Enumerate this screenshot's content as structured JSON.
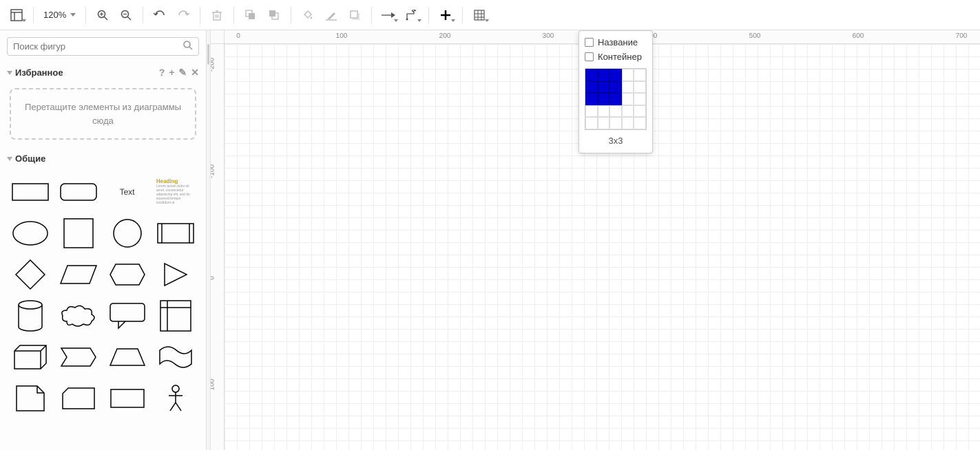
{
  "toolbar": {
    "zoom_label": "120%"
  },
  "sidebar": {
    "search_placeholder": "Поиск фигур",
    "favorites_title": "Избранное",
    "favorites_help": "?",
    "favorites_drop_hint": "Перетащите элементы из диаграммы сюда",
    "general_title": "Общие",
    "shape_text_label": "Text",
    "shape_heading_label": "Heading",
    "shape_heading_body": "Lorem ipsum dolor sit amet, consectetur adipisicing elit, sed do eiusmod tempor incididunt ut"
  },
  "ruler": {
    "h_ticks": [
      "0",
      "100",
      "200",
      "300",
      "400",
      "500",
      "600",
      "700"
    ],
    "v_ticks": [
      "-200",
      "-100",
      "0",
      "100"
    ]
  },
  "popup": {
    "title_label": "Название",
    "container_label": "Контейнер",
    "size_label": "3x3",
    "rows_on": 3,
    "cols_on": 3,
    "rows_total": 5,
    "cols_total": 5
  }
}
